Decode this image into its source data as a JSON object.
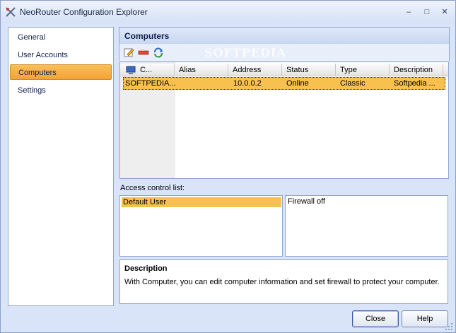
{
  "window": {
    "title": "NeoRouter Configuration Explorer"
  },
  "nav": {
    "items": [
      {
        "label": "General"
      },
      {
        "label": "User Accounts"
      },
      {
        "label": "Computers"
      },
      {
        "label": "Settings"
      }
    ],
    "active_index": 2
  },
  "main": {
    "title": "Computers",
    "watermark": "SOFTPEDIA",
    "grid": {
      "columns": [
        "C...",
        "Alias",
        "Address",
        "Status",
        "Type",
        "Description"
      ],
      "rows": [
        {
          "computer": "SOFTPEDIA...",
          "alias": "",
          "address": "10.0.0.2",
          "status": "Online",
          "type": "Classic",
          "description": "Softpedia ..."
        }
      ]
    },
    "acl": {
      "label": "Access control list:",
      "items": [
        "Default User"
      ],
      "firewall": "Firewall off"
    },
    "description": {
      "title": "Description",
      "text": "With Computer, you can edit computer information and set firewall to protect your computer."
    }
  },
  "buttons": {
    "close": "Close",
    "help": "Help"
  },
  "colors": {
    "selection": "#f8c04e",
    "accent": "#8ea6cf",
    "window_bg": "#d9e4f8"
  }
}
